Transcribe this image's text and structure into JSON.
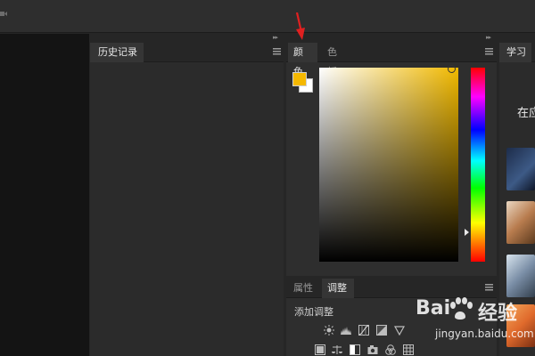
{
  "history_panel": {
    "tab_label": "历史记录"
  },
  "color_panel": {
    "tabs": [
      {
        "label": "颜色",
        "active": true
      },
      {
        "label": "色板",
        "active": false
      }
    ],
    "foreground_color": "#f5b800",
    "background_color": "#ffffff",
    "hue_color": "#f1b900"
  },
  "adjust_panel": {
    "tabs": [
      {
        "label": "属性",
        "active": false
      },
      {
        "label": "调整",
        "active": true
      }
    ],
    "add_adjustment_label": "添加调整",
    "icons_row1": [
      "brightness-contrast-icon",
      "levels-icon",
      "curves-icon",
      "exposure-icon",
      "gradient-triangle-icon"
    ],
    "icons_row2": [
      "color-balance-icon",
      "scale-balance-icon",
      "black-white-icon",
      "photo-filter-icon",
      "channel-mixer-icon",
      "color-lookup-icon"
    ]
  },
  "learn_panel": {
    "tab_label": "学习",
    "heading": "在应"
  },
  "watermark": {
    "brand_left": "Bai",
    "brand_right": "经验",
    "url": "jingyan.baidu.com"
  },
  "colors": {
    "accent_arrow": "#e02020",
    "panel_bg": "#2e2e2e",
    "canvas_bg": "#141414"
  }
}
